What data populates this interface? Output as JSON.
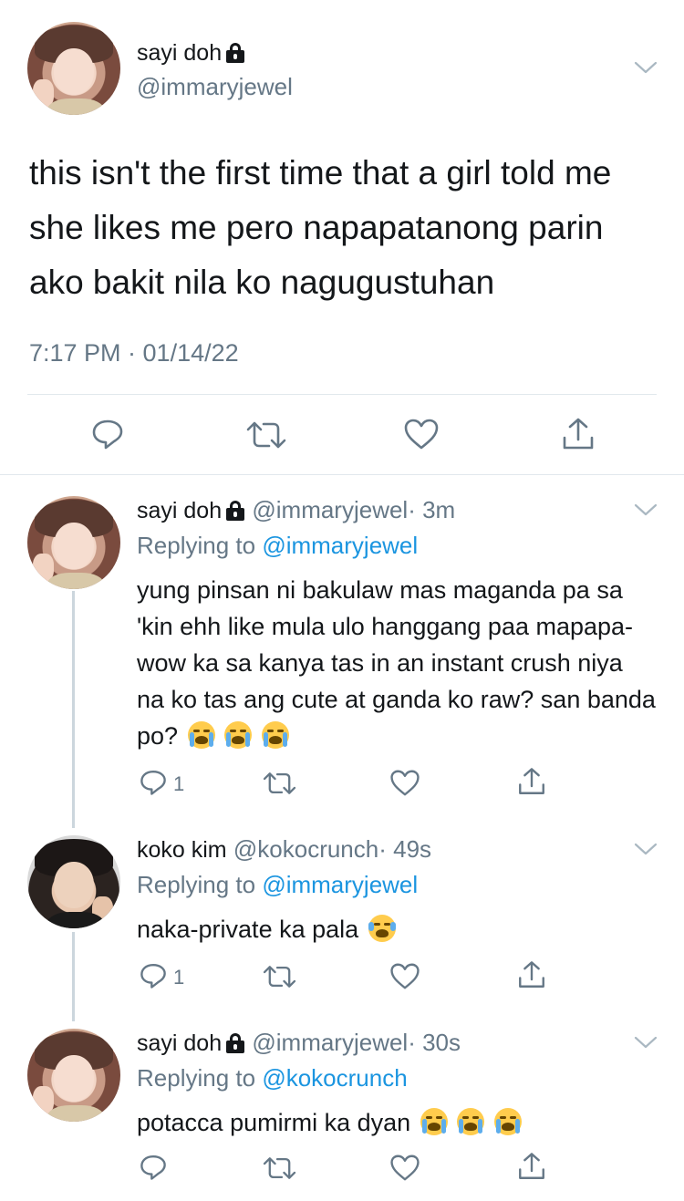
{
  "main_tweet": {
    "display_name": "sayi doh",
    "handle": "@immaryjewel",
    "text": "this isn't the first time that a girl told me she likes me pero napapatanong parin ako bakit nila ko nagugustuhan",
    "timestamp": "7:17 PM · 01/14/22"
  },
  "replies": [
    {
      "display_name": "sayi doh",
      "handle": "@immaryjewel",
      "age": "· 3m",
      "replying_prefix": "Replying to",
      "replying_handle": "@immaryjewel",
      "text": "yung pinsan ni bakulaw mas maganda pa sa 'kin ehh like mula ulo hanggang paa mapapa-wow ka sa kanya tas in an instant crush niya na ko tas ang cute at ganda ko raw? san banda po?",
      "reply_count": "1"
    },
    {
      "display_name": "koko kim",
      "handle": "@kokocrunch",
      "age": "· 49s",
      "replying_prefix": "Replying to",
      "replying_handle": "@immaryjewel",
      "text": "naka-private ka pala",
      "reply_count": "1"
    },
    {
      "display_name": "sayi doh",
      "handle": "@immaryjewel",
      "age": "· 30s",
      "replying_prefix": "Replying to",
      "replying_handle": "@kokocrunch",
      "text": "potacca pumirmi ka dyan",
      "reply_count": ""
    }
  ],
  "icons": [
    "reply-icon",
    "retweet-icon",
    "like-icon",
    "share-icon",
    "lock-icon",
    "chevron-down-icon",
    "loudly-crying-face-emoji",
    "tears-of-joy-emoji"
  ],
  "colors": {
    "text": "#14171a",
    "muted": "#657786",
    "link": "#1b95e0",
    "divider": "#e1e8ed"
  }
}
